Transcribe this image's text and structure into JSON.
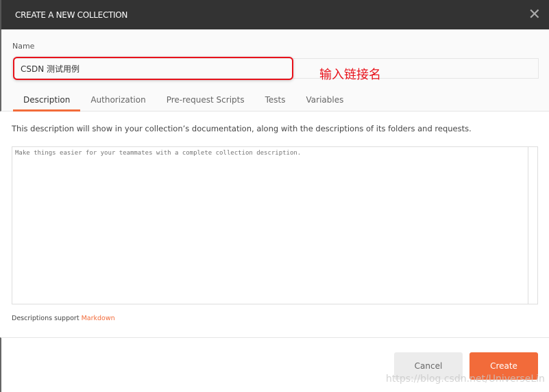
{
  "dialog": {
    "title": "CREATE A NEW COLLECTION",
    "close_icon": "close-icon"
  },
  "name": {
    "label": "Name",
    "value": "CSDN 测试用例"
  },
  "annotation": "输入链接名",
  "tabs": [
    {
      "label": "Description",
      "active": true
    },
    {
      "label": "Authorization"
    },
    {
      "label": "Pre-request Scripts"
    },
    {
      "label": "Tests"
    },
    {
      "label": "Variables"
    }
  ],
  "description": {
    "text": "This description will show in your collection’s documentation, along with the descriptions of its folders and requests.",
    "placeholder": "Make things easier for your teammates with a complete collection description.",
    "support_text": "Descriptions support ",
    "markdown_link": "Markdown"
  },
  "buttons": {
    "cancel": "Cancel",
    "create": "Create"
  },
  "watermark": "https://blog.csdn.net/UniverseLin",
  "colors": {
    "accent": "#f26b3a",
    "header": "#333333",
    "annotation": "#e8121b"
  }
}
